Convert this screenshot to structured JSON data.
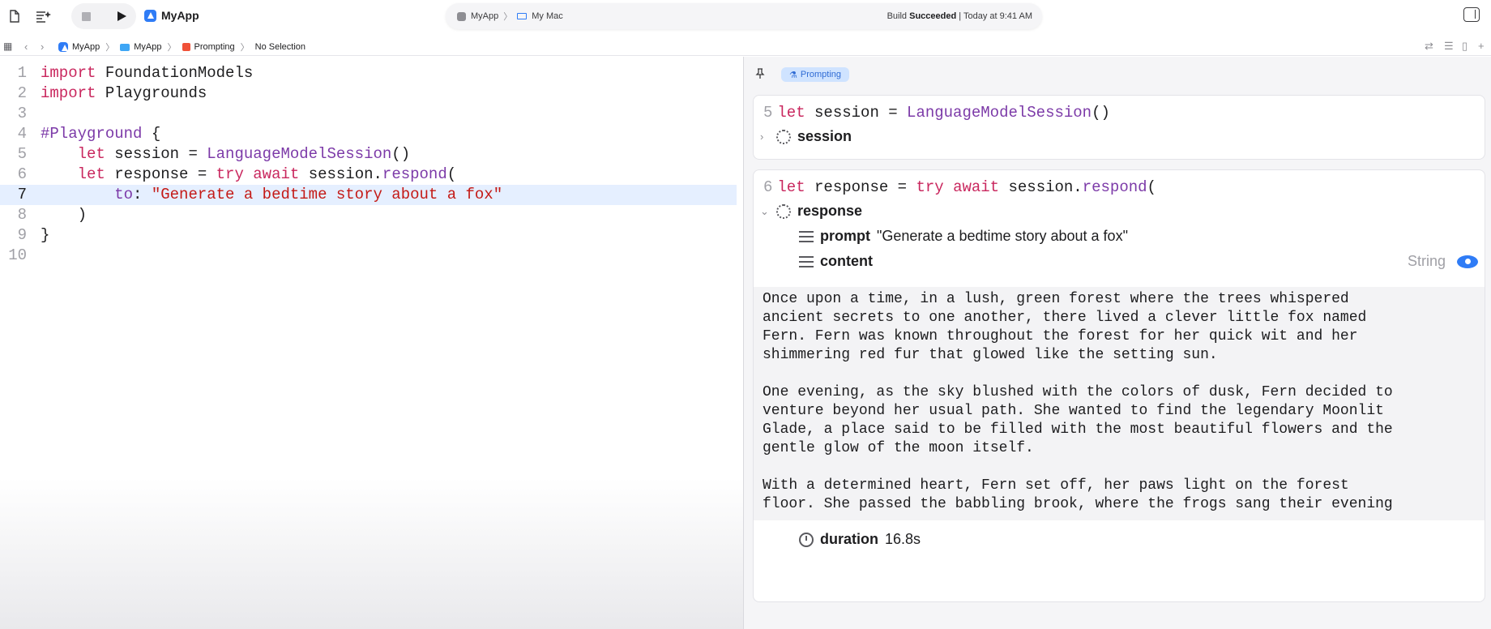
{
  "toolbar": {
    "app_name": "MyApp",
    "scheme_target": "MyApp",
    "scheme_destination": "My Mac",
    "build_word": "Build",
    "build_result": "Succeeded",
    "build_time": "| Today at 9:41 AM"
  },
  "jumpbar": {
    "project": "MyApp",
    "group": "MyApp",
    "file": "Prompting",
    "selection": "No Selection"
  },
  "editor": {
    "line_numbers": [
      "1",
      "2",
      "3",
      "4",
      "5",
      "6",
      "7",
      "8",
      "9",
      "10"
    ],
    "l1_kw": "import",
    "l1_rest": " FoundationModels",
    "l2_kw": "import",
    "l2_rest": " Playgrounds",
    "l4_macro": "#Playground",
    "l4_rest": " {",
    "l5_indent": "    ",
    "l5_kw": "let",
    "l5_mid": " session = ",
    "l5_type": "LanguageModelSession",
    "l5_end": "()",
    "l6_indent": "    ",
    "l6_kw1": "let",
    "l6_mid": " response = ",
    "l6_kw2": "try",
    "l6_sp": " ",
    "l6_kw3": "await",
    "l6_mid2": " session.",
    "l6_method": "respond",
    "l6_end": "(",
    "l7_indent": "        ",
    "l7_label": "to",
    "l7_colon": ": ",
    "l7_string": "\"Generate a bedtime story about a fox\"",
    "l8_text": "    )",
    "l9_text": "}"
  },
  "canvas": {
    "tag_label": "Prompting",
    "card1": {
      "line_number": "5",
      "kw": "let",
      "mid": " session = ",
      "type": "LanguageModelSession",
      "end": "()",
      "item_name": "session"
    },
    "card2": {
      "line_number": "6",
      "kw1": "let",
      "mid": " response = ",
      "kw2": "try",
      "sp": " ",
      "kw3": "await",
      "mid2": " session.",
      "method": "respond",
      "end": "(",
      "item_name": "response",
      "prompt_label": "prompt",
      "prompt_value": "\"Generate a bedtime story about a fox\"",
      "content_label": "content",
      "content_type": "String",
      "story_p1": "Once upon a time, in a lush, green forest where the trees whispered\nancient secrets to one another, there lived a clever little fox named\nFern. Fern was known throughout the forest for her quick wit and her\nshimmering red fur that glowed like the setting sun.",
      "story_p2": "One evening, as the sky blushed with the colors of dusk, Fern decided to\nventure beyond her usual path. She wanted to find the legendary Moonlit\nGlade, a place said to be filled with the most beautiful flowers and the\ngentle glow of the moon itself.",
      "story_p3": "With a determined heart, Fern set off, her paws light on the forest\nfloor. She passed the babbling brook, where the frogs sang their evening",
      "duration_label": "duration",
      "duration_value": "16.8s"
    }
  },
  "colors": {
    "keyword": "#c9275e",
    "type": "#7c3aa8",
    "string": "#c41a16",
    "accent": "#2f7cf6",
    "highlight_line": "#e5efff"
  }
}
